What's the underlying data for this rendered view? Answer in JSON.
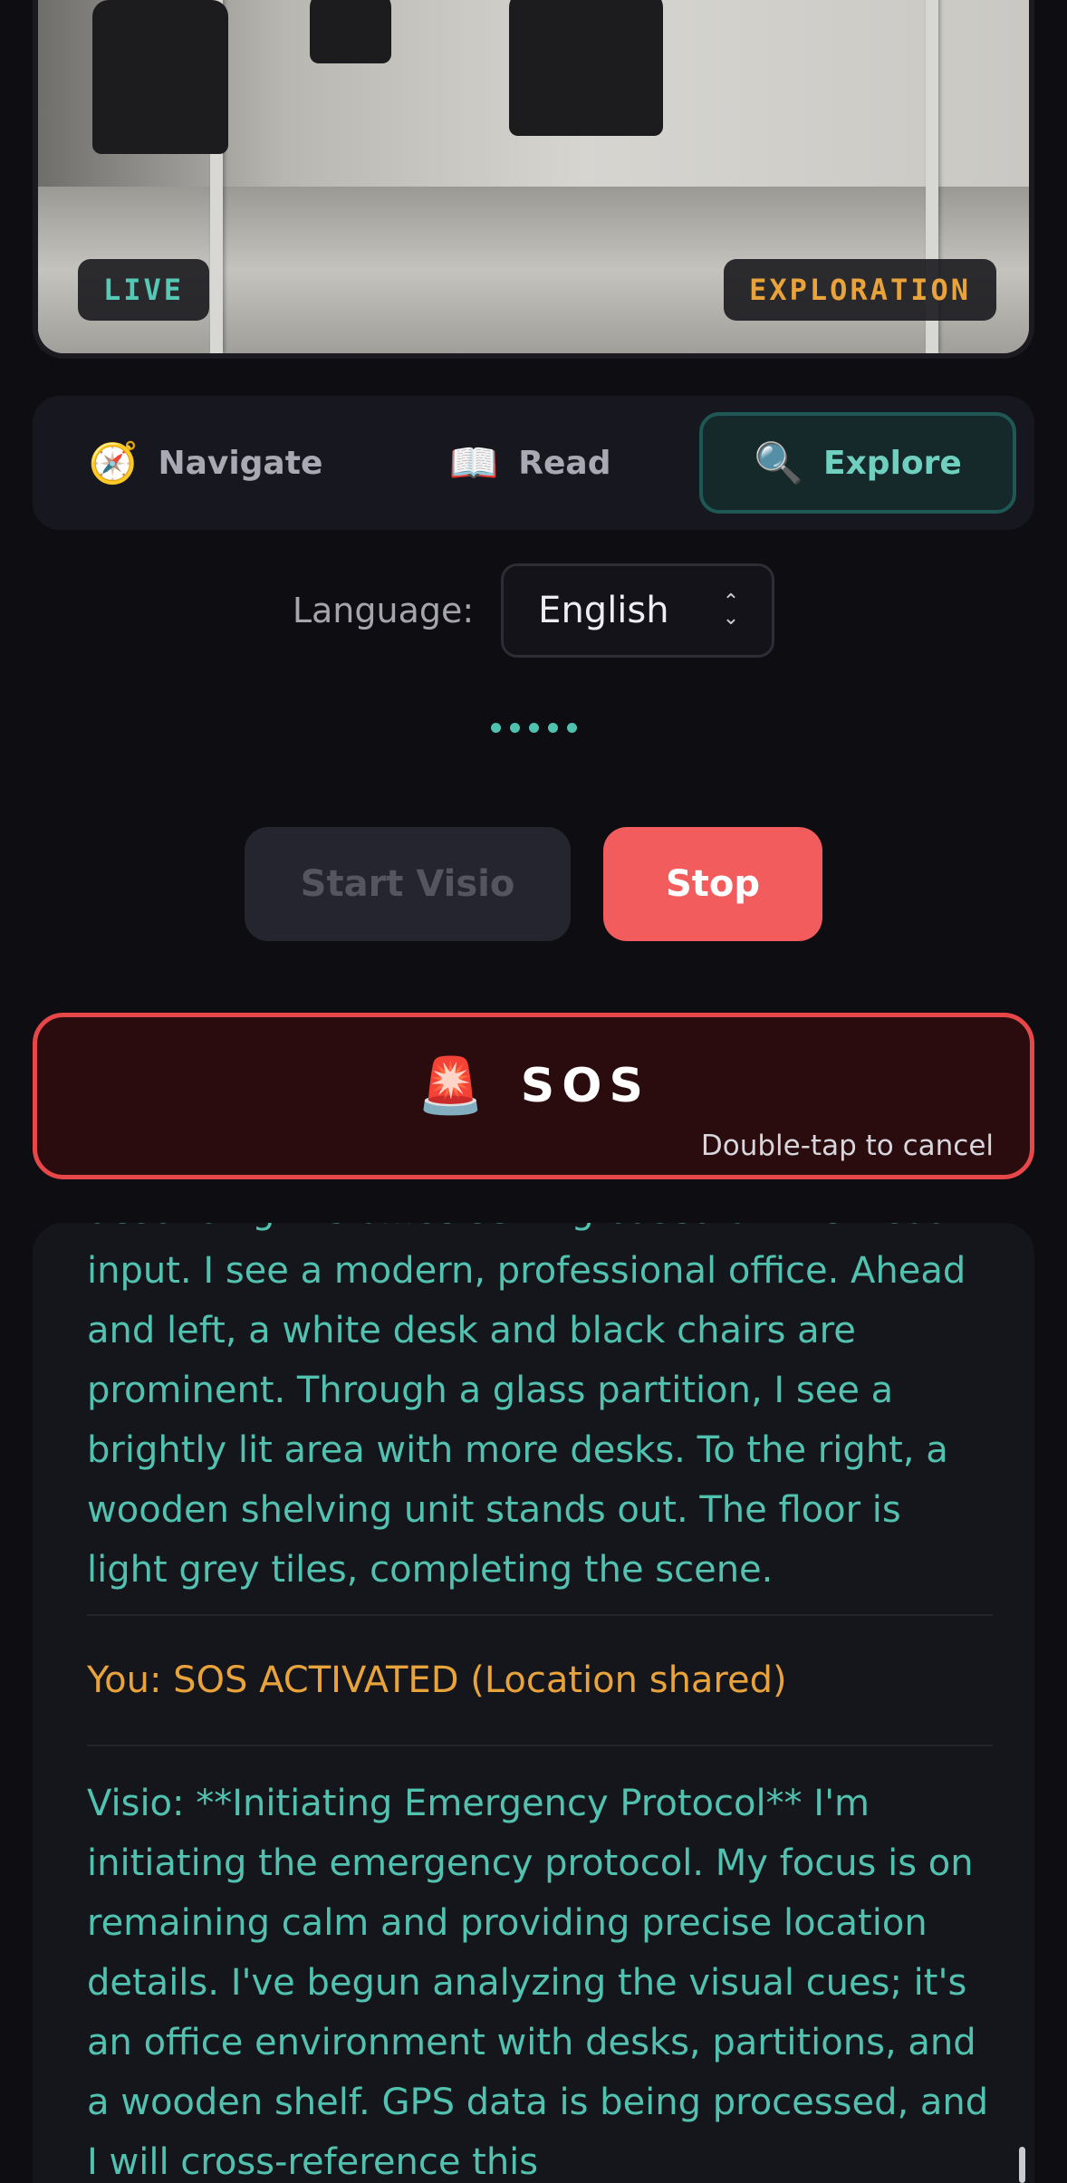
{
  "camera": {
    "live_badge": "LIVE",
    "mode_badge": "EXPLORATION"
  },
  "modes": [
    {
      "icon": "compass-icon",
      "glyph": "🧭",
      "label": "Navigate",
      "active": false
    },
    {
      "icon": "book-icon",
      "glyph": "📖",
      "label": "Read",
      "active": false
    },
    {
      "icon": "magnifier-icon",
      "glyph": "🔍",
      "label": "Explore",
      "active": true
    }
  ],
  "language": {
    "label": "Language:",
    "selected": "English"
  },
  "controls": {
    "start_label": "Start Visio",
    "stop_label": "Stop"
  },
  "sos": {
    "icon": "siren-icon",
    "glyph": "🚨",
    "label": "SOS",
    "hint": "Double-tap to cancel"
  },
  "log": {
    "message_1": "describing the office setting based on the visual input. I see a modern, professional office. Ahead and left, a white desk and black chairs are prominent. Through a glass partition, I see a brightly lit area with more desks. To the right, a wooden shelving unit stands out. The floor is light grey tiles, completing the scene.",
    "message_2": "You: SOS ACTIVATED (Location shared)",
    "message_3": "Visio: **Initiating Emergency Protocol** I'm initiating the emergency protocol. My focus is on remaining calm and providing precise location details. I've begun analyzing the visual cues; it's an office environment with desks, partitions, and a wooden shelf. GPS data is being processed, and I will cross-reference this"
  },
  "colors": {
    "accent_teal": "#52c2b0",
    "accent_orange": "#e9a33b",
    "stop_red": "#f25c5c",
    "sos_border": "#e8474a"
  }
}
